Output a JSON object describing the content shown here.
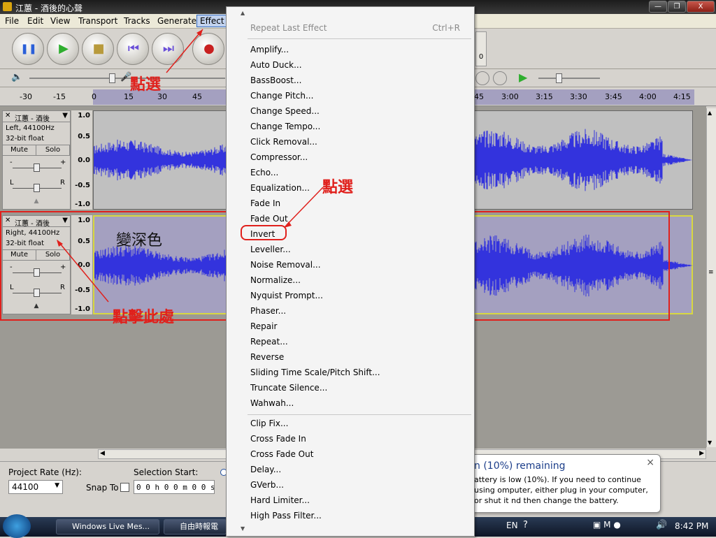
{
  "window": {
    "title": "江蕙 - 酒後的心聲",
    "controls": [
      "—",
      "❐",
      "X"
    ]
  },
  "menubar": [
    "File",
    "Edit",
    "View",
    "Transport",
    "Tracks",
    "Generate",
    "Effect"
  ],
  "toolbar": {
    "buttons": [
      {
        "name": "pause",
        "glyph": "❚❚",
        "color": "#2a5fd8"
      },
      {
        "name": "play",
        "glyph": "▶",
        "color": "#2fae2f"
      },
      {
        "name": "stop",
        "glyph": "■",
        "color": "#b89a3c"
      },
      {
        "name": "skip-start",
        "glyph": "⏮",
        "color": "#6a4fd8"
      },
      {
        "name": "skip-end",
        "glyph": "⏭",
        "color": "#6a4fd8"
      },
      {
        "name": "record",
        "glyph": "●",
        "color": "#c82020"
      }
    ],
    "right_digit": "0"
  },
  "ruler": {
    "ticks": [
      "-30",
      "-15",
      "0",
      "15",
      "30",
      "45",
      "3:45",
      "4:00",
      "4:15",
      "3:00",
      "3:15",
      "3:30",
      "45"
    ]
  },
  "tracks": [
    {
      "name": "江蕙 - 酒後",
      "info1": "Left, 44100Hz",
      "info2": "32-bit float",
      "mute": "Mute",
      "solo": "Solo",
      "pan_l": "L",
      "pan_r": "R",
      "gain_minus": "-",
      "gain_plus": "+",
      "y": [
        "1.0",
        "0.5",
        "0.0",
        "-0.5",
        "-1.0"
      ]
    },
    {
      "name": "江蕙 - 酒後",
      "info1": "Right, 44100Hz",
      "info2": "32-bit float",
      "mute": "Mute",
      "solo": "Solo",
      "pan_l": "L",
      "pan_r": "R",
      "gain_minus": "-",
      "gain_plus": "+",
      "y": [
        "1.0",
        "0.5",
        "0.0",
        "-0.5",
        "-1.0"
      ]
    }
  ],
  "annotations": {
    "click_menu": "點選",
    "click_item": "點選",
    "darken": "變深色",
    "click_here": "點擊此處"
  },
  "effect_menu": {
    "repeat": "Repeat Last Effect",
    "repeat_shortcut": "Ctrl+R",
    "group1": [
      "Amplify...",
      "Auto Duck...",
      "BassBoost...",
      "Change Pitch...",
      "Change Speed...",
      "Change Tempo...",
      "Click Removal...",
      "Compressor...",
      "Echo...",
      "Equalization...",
      "Fade In",
      "Fade Out",
      "Invert",
      "Leveller...",
      "Noise Removal...",
      "Normalize...",
      "Nyquist Prompt...",
      "Phaser...",
      "Repair",
      "Repeat...",
      "Reverse",
      "Sliding Time Scale/Pitch Shift...",
      "Truncate Silence...",
      "Wahwah..."
    ],
    "group2": [
      "Clip Fix...",
      "Cross Fade In",
      "Cross Fade Out",
      "Delay...",
      "GVerb...",
      "Hard Limiter...",
      "High Pass Filter..."
    ],
    "highlighted": "Invert"
  },
  "statusbar": {
    "project_rate_label": "Project Rate (Hz):",
    "project_rate": "44100",
    "snap_label": "Snap To",
    "selection_start_label": "Selection Start:",
    "selection_value": "0 0 h 0 0 m 0 0 s"
  },
  "balloon": {
    "title": "n (10%) remaining",
    "body": "attery is low (10%). If you need to continue using omputer, either plug in your computer, or shut it nd then change the battery.",
    "close": "×"
  },
  "taskbar": {
    "items": [
      "Windows Live Mes...",
      "自由時報電"
    ],
    "lang": "EN",
    "clock": "8:42 PM"
  },
  "colors": {
    "waveform": "#3333dd",
    "wave_bg": "#c0c0c0",
    "selected_bg": "#a4a0c0",
    "annotation": "#e0201c"
  }
}
